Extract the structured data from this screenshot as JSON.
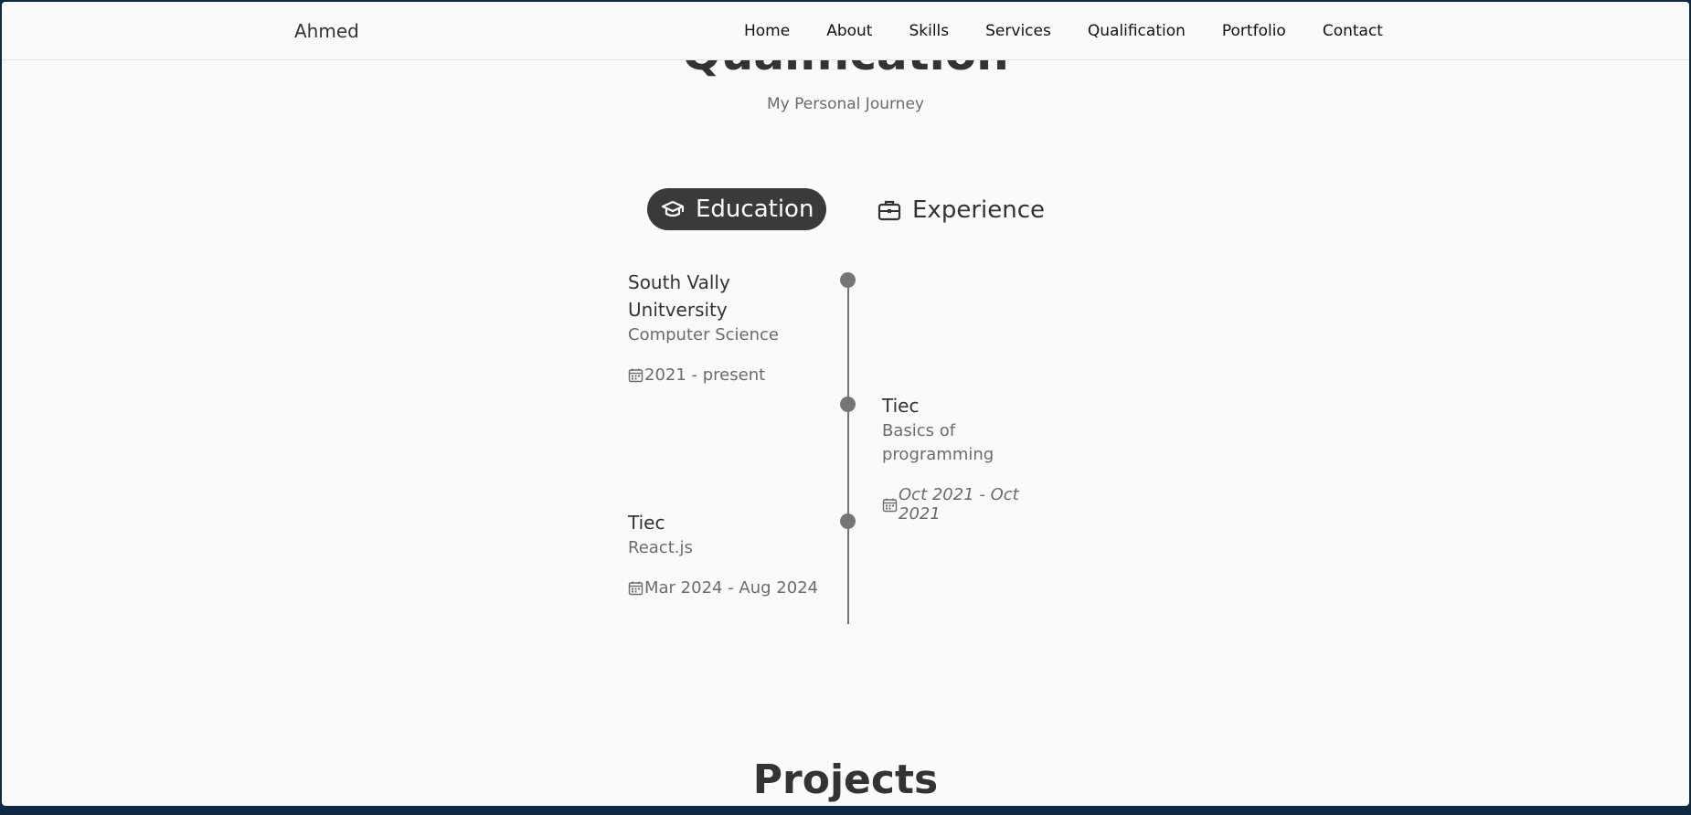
{
  "navbar": {
    "logo": "Ahmed",
    "links": [
      "Home",
      "About",
      "Skills",
      "Services",
      "Qualification",
      "Portfolio",
      "Contact"
    ]
  },
  "qualification": {
    "title": "Qualification",
    "subtitle": "My Personal Journey",
    "tabs": {
      "education": "Education",
      "experience": "Experience"
    },
    "entries": [
      {
        "title": "South Vally Unitversity",
        "subtitle": "Computer Science",
        "date": "2021 - present"
      },
      {
        "title": "Tiec",
        "subtitle": "Basics of programming",
        "date": "Oct 2021 - Oct 2021"
      },
      {
        "title": "Tiec",
        "subtitle": "React.js",
        "date": "Mar 2024 - Aug 2024"
      }
    ]
  },
  "projects": {
    "title": "Projects"
  },
  "icons": {
    "education_tab": "graduation-cap-icon",
    "experience_tab": "briefcase-icon",
    "date": "calendar-icon"
  },
  "colors": {
    "page_background": "#fafafa",
    "active_tab": "#3a3a3a",
    "timeline": "#757575",
    "text_dark": "#333333",
    "text_muted": "#6b6b6b",
    "frame": "#0f2a44"
  }
}
